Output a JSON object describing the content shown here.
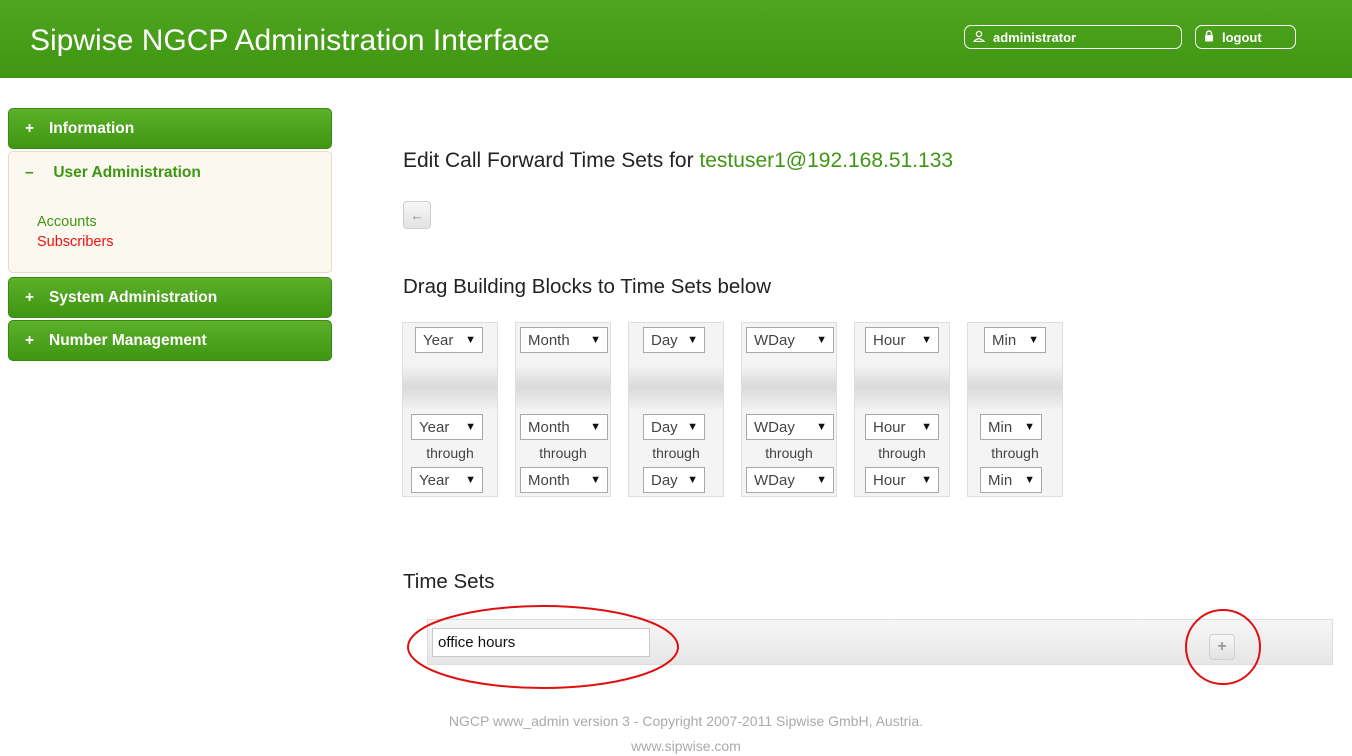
{
  "header": {
    "title": "Sipwise NGCP Administration Interface",
    "user_label": "administrator",
    "logout_label": "logout",
    "user_icon": "user-icon",
    "logout_icon": "lock-icon"
  },
  "sidebar": {
    "information": {
      "sign": "+",
      "label": "Information"
    },
    "user_admin": {
      "sign": "–",
      "label": "User Administration",
      "links": [
        "Accounts",
        "Subscribers"
      ]
    },
    "system_admin": {
      "sign": "+",
      "label": "System Administration"
    },
    "number_mgmt": {
      "sign": "+",
      "label": "Number Management"
    }
  },
  "main": {
    "title_prefix": "Edit Call Forward Time Sets for ",
    "title_user": "testuser1@192.168.51.133",
    "back_icon": "←",
    "blocks_heading": "Drag Building Blocks to Time Sets below",
    "blocks": [
      {
        "label": "Year",
        "through": "through"
      },
      {
        "label": "Month",
        "through": "through"
      },
      {
        "label": "Day",
        "through": "through"
      },
      {
        "label": "WDay",
        "through": "through"
      },
      {
        "label": "Hour",
        "through": "through"
      },
      {
        "label": "Min",
        "through": "through"
      }
    ],
    "arrow": "▼",
    "time_sets_heading": "Time Sets",
    "time_set_value": "office hours",
    "add_icon": "+"
  },
  "footer": {
    "line1": "NGCP www_admin version 3 - Copyright 2007-2011 Sipwise GmbH, Austria.",
    "line2": "www.sipwise.com"
  },
  "colors": {
    "brand_green": "#3f9612",
    "annotation_red": "#e01010"
  }
}
